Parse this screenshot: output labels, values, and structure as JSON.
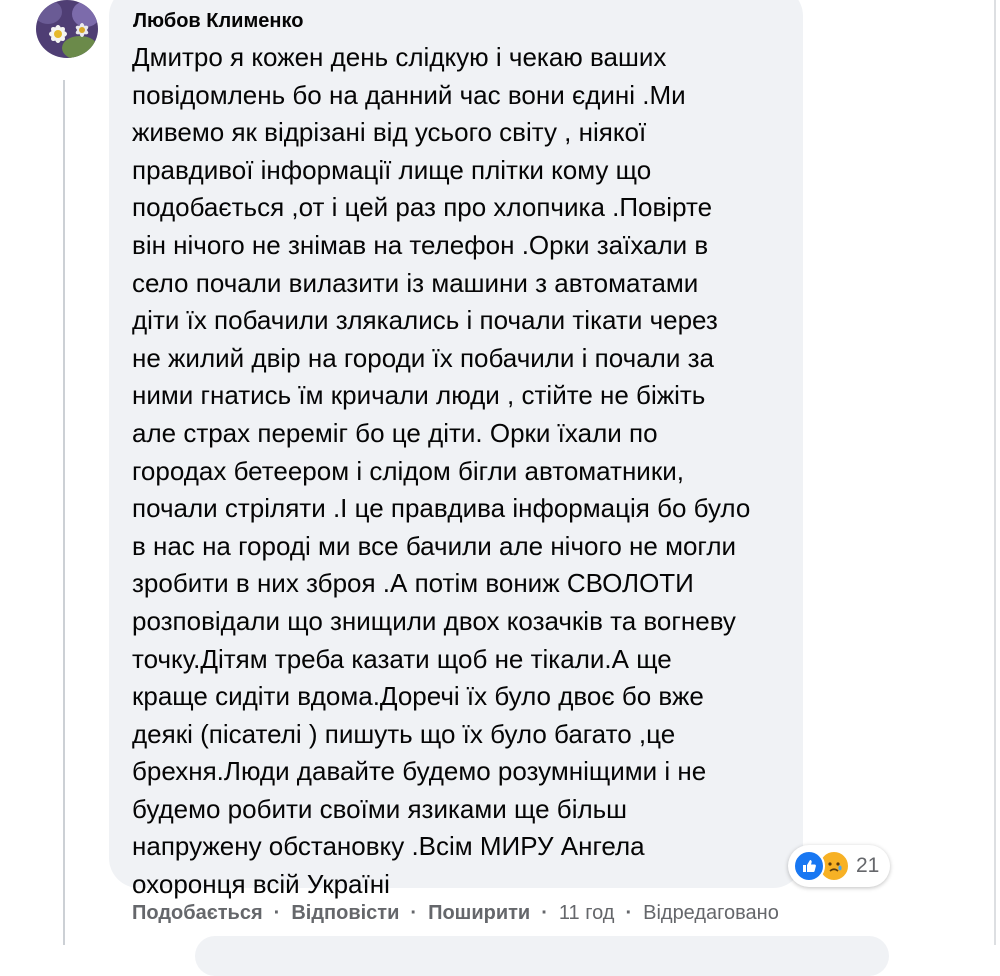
{
  "comment": {
    "author": "Любов Клименко",
    "text": "Дмитро я кожен день слідкую і чекаю ваших\nповідомлень бо на данний час вони єдині .Ми\nживемо як відрізані від усього світу , ніякої\nправдивої інформації лище плітки кому що\nподобається ,от і цей раз про хлопчика .Повірте\nвін нічого не знімав на телефон .Орки заїхали в\nсело почали вилазити із машини з автоматами\nдіти їх побачили злякались і почали тікати через\nне жилий двір на городи їх побачили і почали за\nними гнатись їм кричали люди , стійте не біжіть\nале страх переміг бо це діти. Орки їхали по\nгородах бетеером і слідом бігли автоматники,\nпочали стріляти .І це правдива інформація бо було\nв нас на городі ми все бачили але нічого не могли\nзробити в них зброя .А потім вониж СВОЛОТИ\nрозповідали що знищили двох козачків та вогневу\nточку.Дітям треба казати щоб не тікали.А ще\nкраще сидіти вдома.Доречі їх було двоє бо вже\nдеякі (пісателі ) пишуть що їх було багато ,це\nбрехня.Люди давайте будемо розумніщими і не\nбудемо робити своїми язиками ще більш\nнапружену обстановку .Всім МИРУ Ангела\nохоронця всій Україні",
    "reactions": {
      "count": "21",
      "icons": [
        "like-icon",
        "care-icon"
      ],
      "like_color": "#1877f2",
      "care_color": "#f7b125"
    },
    "actions": {
      "like": "Подобається",
      "reply": "Відповісти",
      "share": "Поширити",
      "time": "11 год",
      "edited": "Відредаговано"
    }
  },
  "colors": {
    "bubble": "#f0f2f5",
    "text": "#050505",
    "secondary_text": "#65676b"
  }
}
